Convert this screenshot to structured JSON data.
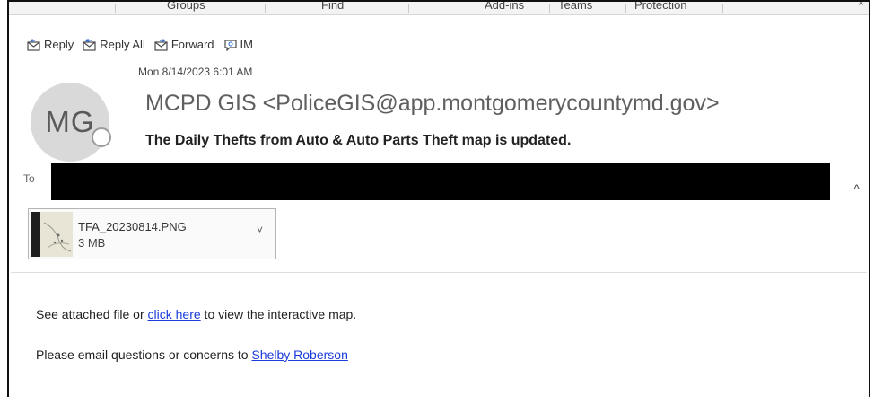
{
  "ribbon": {
    "groups": [
      "Groups",
      "Find",
      "Add-ins",
      "Teams",
      "Protection"
    ],
    "collapse_glyph": "^"
  },
  "actions": {
    "reply_label": "Reply",
    "reply_all_label": "Reply All",
    "forward_label": "Forward",
    "im_label": "IM"
  },
  "message": {
    "date": "Mon 8/14/2023 6:01 AM",
    "avatar_initials": "MG",
    "sender": "MCPD GIS <PoliceGIS@app.montgomerycountymd.gov>",
    "subject": "The Daily Thefts from Auto & Auto Parts Theft map is updated.",
    "to_label": "To",
    "collapse_glyph": "^"
  },
  "attachment": {
    "filename": "TFA_20230814.PNG",
    "size": "3 MB",
    "dropdown_glyph": "˅"
  },
  "body": {
    "line1_prefix": "See attached file or ",
    "line1_link": "click here",
    "line1_suffix": " to view the interactive map.",
    "line2_prefix": "Please email questions or concerns to ",
    "line2_link": "Shelby Roberson"
  },
  "colors": {
    "link": "#1a3cdd",
    "avatar_bg": "#d9d9d9",
    "redaction": "#000000"
  }
}
